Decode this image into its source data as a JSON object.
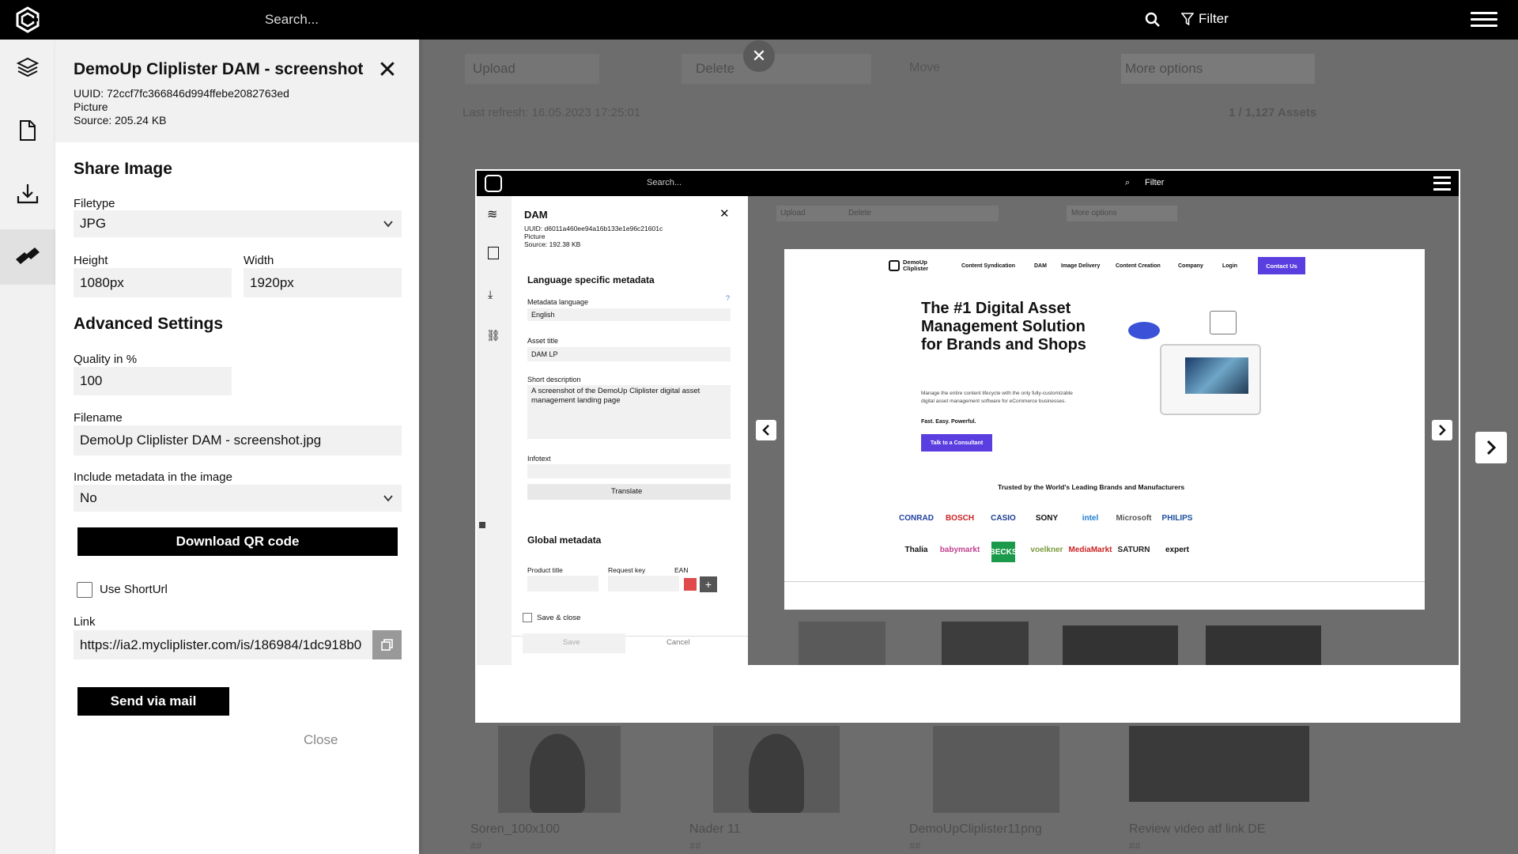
{
  "topbar": {
    "search_placeholder": "Search...",
    "filter_label": "Filter"
  },
  "asset": {
    "title": "DemoUp Cliplister DAM - screenshot",
    "uuid": "UUID: 72ccf7fc366846d994ffebe2082763ed",
    "type": "Picture",
    "source": "Source: 205.24 KB"
  },
  "share": {
    "title": "Share Image",
    "filetype_label": "Filetype",
    "filetype_value": "JPG",
    "height_label": "Height",
    "height_value": "1080px",
    "width_label": "Width",
    "width_value": "1920px",
    "advanced_title": "Advanced Settings",
    "quality_label": "Quality in %",
    "quality_value": "100",
    "filename_label": "Filename",
    "filename_value": "DemoUp Cliplister DAM - screenshot.jpg",
    "metadata_label": "Include metadata in the image",
    "metadata_value": "No",
    "qr_button": "Download QR code",
    "shorturl_label": "Use ShortUrl",
    "link_label": "Link",
    "link_value": "https://ia2.mycliplister.com/is/186984/1dc918b0",
    "send_button": "Send via mail",
    "close_link": "Close"
  },
  "background": {
    "upload": "Upload",
    "delete": "Delete",
    "move": "Move",
    "more_options": "More options",
    "last_refresh": "Last refresh: 16.05.2023 17:25:01",
    "asset_count": "1 / 1,127 Assets",
    "items": [
      {
        "name": "Soren_100x100",
        "tag": "##"
      },
      {
        "name": "Nader 11",
        "tag": "##"
      },
      {
        "name": "DemoUpCliplister11png",
        "tag": "##"
      },
      {
        "name": "Review video atf link DE",
        "tag": "##"
      }
    ]
  },
  "preview": {
    "search": "Search...",
    "filter": "Filter",
    "panel_title": "DAM",
    "uuid": "UUID: d6011a460ee94a16b133e1e96c21601c",
    "type": "Picture",
    "source": "Source: 192.38 KB",
    "lang_title": "Language specific metadata",
    "meta_lang_label": "Metadata language",
    "meta_lang_value": "English",
    "asset_title_label": "Asset title",
    "asset_title_value": "DAM LP",
    "short_desc_label": "Short description",
    "short_desc_value": "A screenshot of the DemoUp Cliplister digital asset management landing page",
    "infotext_label": "Infotext",
    "translate_button": "Translate",
    "global_title": "Global metadata",
    "product_title_label": "Product title",
    "request_key_label": "Request key",
    "ean_label": "EAN",
    "save_close_label": "Save & close",
    "save_button": "Save",
    "cancel_button": "Cancel",
    "upload": "Upload",
    "delete": "Delete",
    "more_options": "More options",
    "site": {
      "brand": "DemoUp Cliplister",
      "nav": [
        "Content Syndication",
        "DAM",
        "Image Delivery",
        "Content Creation",
        "Company",
        "Login"
      ],
      "contact": "Contact Us",
      "headline": "The #1 Digital Asset Management Solution for Brands and Shops",
      "sub": "Manage the entire content lifecycle with the only fully-customizable digital asset management software for eCommerce businesses.",
      "tagline": "Fast. Easy. Powerful.",
      "cta": "Talk to a Consultant",
      "trusted": "Trusted by the World's Leading Brands and Manufacturers",
      "logos_row1": [
        "CONRAD",
        "BOSCH",
        "CASIO",
        "SONY",
        "intel",
        "Microsoft",
        "PHILIPS"
      ],
      "logos_row2": [
        "Thalia",
        "babymarkt",
        "BECKS",
        "voelkner",
        "MediaMarkt",
        "SATURN",
        "expert"
      ]
    }
  }
}
